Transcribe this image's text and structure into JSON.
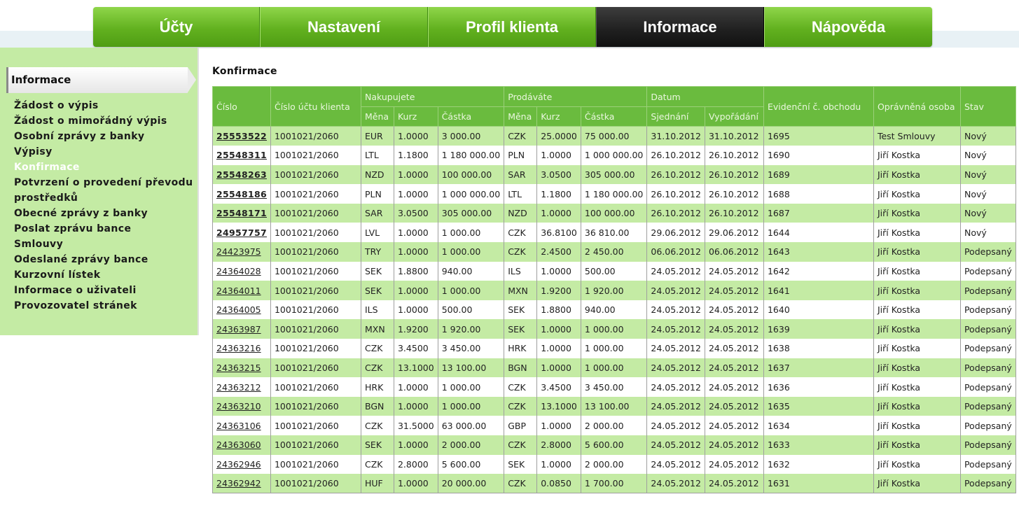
{
  "nav": {
    "tabs": [
      "Účty",
      "Nastavení",
      "Profil klienta",
      "Informace",
      "Nápověda"
    ],
    "active_index": 3
  },
  "sidebar": {
    "heading": "Informace",
    "items": [
      "Žádost o výpis",
      "Žádost o mimořádný výpis",
      "Osobní zprávy z banky",
      "Výpisy",
      "Konfirmace",
      "Potvrzení o provedení převodu prostředků",
      "Obecné zprávy z banky",
      "Poslat zprávu bance",
      "Smlouvy",
      "Odeslané zprávy bance",
      "Kurzovní lístek",
      "Informace o uživateli",
      "Provozovatel stránek"
    ],
    "active_index": 4
  },
  "main": {
    "title": "Konfirmace",
    "table": {
      "headers": {
        "cislo": "Číslo",
        "cislo_uctu": "Číslo účtu klienta",
        "nakupujete": "Nakupujete",
        "prodavate": "Prodáváte",
        "datum": "Datum",
        "evidencni": "Evidenční č. obchodu",
        "opravnena": "Oprávněná osoba",
        "stav": "Stav",
        "mena": "Měna",
        "kurz": "Kurz",
        "castka": "Částka",
        "sjednani": "Sjednání",
        "vyporadani": "Vypořádání"
      },
      "rows": [
        {
          "cislo": "25553522",
          "ucet": "1001021/2060",
          "buy_mena": "EUR",
          "buy_kurz": "1.0000",
          "buy_castka": "3 000.00",
          "sell_mena": "CZK",
          "sell_kurz": "25.0000",
          "sell_castka": "75 000.00",
          "sjednani": "31.10.2012",
          "vyporadani": "31.10.2012",
          "evid": "1695",
          "osoba": "Test Smlouvy",
          "stav": "Nový",
          "bold": true
        },
        {
          "cislo": "25548311",
          "ucet": "1001021/2060",
          "buy_mena": "LTL",
          "buy_kurz": "1.1800",
          "buy_castka": "1 180 000.00",
          "sell_mena": "PLN",
          "sell_kurz": "1.0000",
          "sell_castka": "1 000 000.00",
          "sjednani": "26.10.2012",
          "vyporadani": "26.10.2012",
          "evid": "1690",
          "osoba": "Jiří Kostka",
          "stav": "Nový",
          "bold": true
        },
        {
          "cislo": "25548263",
          "ucet": "1001021/2060",
          "buy_mena": "NZD",
          "buy_kurz": "1.0000",
          "buy_castka": "100 000.00",
          "sell_mena": "SAR",
          "sell_kurz": "3.0500",
          "sell_castka": "305 000.00",
          "sjednani": "26.10.2012",
          "vyporadani": "26.10.2012",
          "evid": "1689",
          "osoba": "Jiří Kostka",
          "stav": "Nový",
          "bold": true
        },
        {
          "cislo": "25548186",
          "ucet": "1001021/2060",
          "buy_mena": "PLN",
          "buy_kurz": "1.0000",
          "buy_castka": "1 000 000.00",
          "sell_mena": "LTL",
          "sell_kurz": "1.1800",
          "sell_castka": "1 180 000.00",
          "sjednani": "26.10.2012",
          "vyporadani": "26.10.2012",
          "evid": "1688",
          "osoba": "Jiří Kostka",
          "stav": "Nový",
          "bold": true
        },
        {
          "cislo": "25548171",
          "ucet": "1001021/2060",
          "buy_mena": "SAR",
          "buy_kurz": "3.0500",
          "buy_castka": "305 000.00",
          "sell_mena": "NZD",
          "sell_kurz": "1.0000",
          "sell_castka": "100 000.00",
          "sjednani": "26.10.2012",
          "vyporadani": "26.10.2012",
          "evid": "1687",
          "osoba": "Jiří Kostka",
          "stav": "Nový",
          "bold": true
        },
        {
          "cislo": "24957757",
          "ucet": "1001021/2060",
          "buy_mena": "LVL",
          "buy_kurz": "1.0000",
          "buy_castka": "1 000.00",
          "sell_mena": "CZK",
          "sell_kurz": "36.8100",
          "sell_castka": "36 810.00",
          "sjednani": "29.06.2012",
          "vyporadani": "29.06.2012",
          "evid": "1644",
          "osoba": "Jiří Kostka",
          "stav": "Nový",
          "bold": true
        },
        {
          "cislo": "24423975",
          "ucet": "1001021/2060",
          "buy_mena": "TRY",
          "buy_kurz": "1.0000",
          "buy_castka": "1 000.00",
          "sell_mena": "CZK",
          "sell_kurz": "2.4500",
          "sell_castka": "2 450.00",
          "sjednani": "06.06.2012",
          "vyporadani": "06.06.2012",
          "evid": "1643",
          "osoba": "Jiří Kostka",
          "stav": "Podepsaný",
          "bold": false
        },
        {
          "cislo": "24364028",
          "ucet": "1001021/2060",
          "buy_mena": "SEK",
          "buy_kurz": "1.8800",
          "buy_castka": "940.00",
          "sell_mena": "ILS",
          "sell_kurz": "1.0000",
          "sell_castka": "500.00",
          "sjednani": "24.05.2012",
          "vyporadani": "24.05.2012",
          "evid": "1642",
          "osoba": "Jiří Kostka",
          "stav": "Podepsaný",
          "bold": false
        },
        {
          "cislo": "24364011",
          "ucet": "1001021/2060",
          "buy_mena": "SEK",
          "buy_kurz": "1.0000",
          "buy_castka": "1 000.00",
          "sell_mena": "MXN",
          "sell_kurz": "1.9200",
          "sell_castka": "1 920.00",
          "sjednani": "24.05.2012",
          "vyporadani": "24.05.2012",
          "evid": "1641",
          "osoba": "Jiří Kostka",
          "stav": "Podepsaný",
          "bold": false
        },
        {
          "cislo": "24364005",
          "ucet": "1001021/2060",
          "buy_mena": "ILS",
          "buy_kurz": "1.0000",
          "buy_castka": "500.00",
          "sell_mena": "SEK",
          "sell_kurz": "1.8800",
          "sell_castka": "940.00",
          "sjednani": "24.05.2012",
          "vyporadani": "24.05.2012",
          "evid": "1640",
          "osoba": "Jiří Kostka",
          "stav": "Podepsaný",
          "bold": false
        },
        {
          "cislo": "24363987",
          "ucet": "1001021/2060",
          "buy_mena": "MXN",
          "buy_kurz": "1.9200",
          "buy_castka": "1 920.00",
          "sell_mena": "SEK",
          "sell_kurz": "1.0000",
          "sell_castka": "1 000.00",
          "sjednani": "24.05.2012",
          "vyporadani": "24.05.2012",
          "evid": "1639",
          "osoba": "Jiří Kostka",
          "stav": "Podepsaný",
          "bold": false
        },
        {
          "cislo": "24363216",
          "ucet": "1001021/2060",
          "buy_mena": "CZK",
          "buy_kurz": "3.4500",
          "buy_castka": "3 450.00",
          "sell_mena": "HRK",
          "sell_kurz": "1.0000",
          "sell_castka": "1 000.00",
          "sjednani": "24.05.2012",
          "vyporadani": "24.05.2012",
          "evid": "1638",
          "osoba": "Jiří Kostka",
          "stav": "Podepsaný",
          "bold": false
        },
        {
          "cislo": "24363215",
          "ucet": "1001021/2060",
          "buy_mena": "CZK",
          "buy_kurz": "13.1000",
          "buy_castka": "13 100.00",
          "sell_mena": "BGN",
          "sell_kurz": "1.0000",
          "sell_castka": "1 000.00",
          "sjednani": "24.05.2012",
          "vyporadani": "24.05.2012",
          "evid": "1637",
          "osoba": "Jiří Kostka",
          "stav": "Podepsaný",
          "bold": false
        },
        {
          "cislo": "24363212",
          "ucet": "1001021/2060",
          "buy_mena": "HRK",
          "buy_kurz": "1.0000",
          "buy_castka": "1 000.00",
          "sell_mena": "CZK",
          "sell_kurz": "3.4500",
          "sell_castka": "3 450.00",
          "sjednani": "24.05.2012",
          "vyporadani": "24.05.2012",
          "evid": "1636",
          "osoba": "Jiří Kostka",
          "stav": "Podepsaný",
          "bold": false
        },
        {
          "cislo": "24363210",
          "ucet": "1001021/2060",
          "buy_mena": "BGN",
          "buy_kurz": "1.0000",
          "buy_castka": "1 000.00",
          "sell_mena": "CZK",
          "sell_kurz": "13.1000",
          "sell_castka": "13 100.00",
          "sjednani": "24.05.2012",
          "vyporadani": "24.05.2012",
          "evid": "1635",
          "osoba": "Jiří Kostka",
          "stav": "Podepsaný",
          "bold": false
        },
        {
          "cislo": "24363106",
          "ucet": "1001021/2060",
          "buy_mena": "CZK",
          "buy_kurz": "31.5000",
          "buy_castka": "63 000.00",
          "sell_mena": "GBP",
          "sell_kurz": "1.0000",
          "sell_castka": "2 000.00",
          "sjednani": "24.05.2012",
          "vyporadani": "24.05.2012",
          "evid": "1634",
          "osoba": "Jiří Kostka",
          "stav": "Podepsaný",
          "bold": false
        },
        {
          "cislo": "24363060",
          "ucet": "1001021/2060",
          "buy_mena": "SEK",
          "buy_kurz": "1.0000",
          "buy_castka": "2 000.00",
          "sell_mena": "CZK",
          "sell_kurz": "2.8000",
          "sell_castka": "5 600.00",
          "sjednani": "24.05.2012",
          "vyporadani": "24.05.2012",
          "evid": "1633",
          "osoba": "Jiří Kostka",
          "stav": "Podepsaný",
          "bold": false
        },
        {
          "cislo": "24362946",
          "ucet": "1001021/2060",
          "buy_mena": "CZK",
          "buy_kurz": "2.8000",
          "buy_castka": "5 600.00",
          "sell_mena": "SEK",
          "sell_kurz": "1.0000",
          "sell_castka": "2 000.00",
          "sjednani": "24.05.2012",
          "vyporadani": "24.05.2012",
          "evid": "1632",
          "osoba": "Jiří Kostka",
          "stav": "Podepsaný",
          "bold": false
        },
        {
          "cislo": "24362942",
          "ucet": "1001021/2060",
          "buy_mena": "HUF",
          "buy_kurz": "1.0000",
          "buy_castka": "20 000.00",
          "sell_mena": "CZK",
          "sell_kurz": "0.0850",
          "sell_castka": "1 700.00",
          "sjednani": "24.05.2012",
          "vyporadani": "24.05.2012",
          "evid": "1631",
          "osoba": "Jiří Kostka",
          "stav": "Podepsaný",
          "bold": false
        }
      ]
    }
  }
}
